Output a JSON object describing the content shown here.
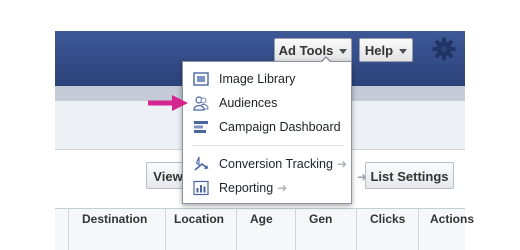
{
  "header": {
    "ad_tools_label": "Ad Tools",
    "help_label": "Help",
    "settings_icon": "gear-icon"
  },
  "ad_tools_menu": {
    "items": [
      {
        "label": "Image Library",
        "icon": "image-library-icon",
        "has_submenu": false
      },
      {
        "label": "Audiences",
        "icon": "audiences-icon",
        "has_submenu": false,
        "highlighted_by_pointer": true
      },
      {
        "label": "Campaign Dashboard",
        "icon": "campaign-dashboard-icon",
        "has_submenu": false
      },
      {
        "label": "Conversion Tracking",
        "icon": "conversion-tracking-icon",
        "has_submenu": true
      },
      {
        "label": "Reporting",
        "icon": "reporting-icon",
        "has_submenu": true
      }
    ]
  },
  "actions": {
    "view_label": "View",
    "list_settings_label": "List Settings"
  },
  "table": {
    "columns": [
      "Destination",
      "Location",
      "Age",
      "Gen",
      "Clicks",
      "Actions"
    ]
  },
  "colors": {
    "header_navy": "#3b5998",
    "pointer_magenta": "#d4268e"
  }
}
